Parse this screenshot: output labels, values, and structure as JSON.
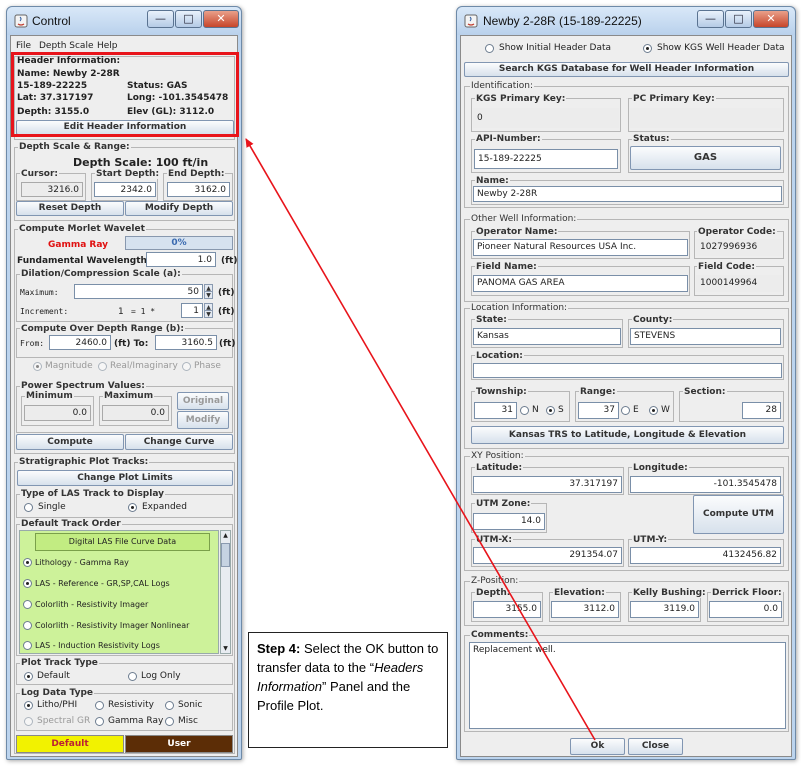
{
  "control": {
    "title": "Control",
    "menu": [
      "File",
      "Depth Scale",
      "Help"
    ],
    "header": {
      "section": "Header Information:",
      "name": "Name: Newby 2-28R",
      "api": "15-189-22225",
      "status": "Status: GAS",
      "lat": "Lat: 37.317197",
      "long": "Long: -101.3545478",
      "depth": "Depth: 3155.0",
      "elev": "Elev (GL): 3112.0",
      "edit_button": "Edit Header Information"
    },
    "depth": {
      "section": "Depth Scale & Range:",
      "scale_label": "Depth Scale: 100 ft/in",
      "cursor_label": "Cursor:",
      "cursor": "3216.0",
      "start_label": "Start Depth:",
      "start": "2342.0",
      "end_label": "End Depth:",
      "end": "3162.0",
      "reset_button": "Reset Depth",
      "modify_button": "Modify Depth"
    },
    "morlet": {
      "section": "Compute Morlet Wavelet",
      "curve": "Gamma Ray",
      "progress": "0%",
      "progress_value": 0,
      "fund_label": "Fundamental Wavelength (Wo):",
      "fund_value": "1.0",
      "ft": "(ft)",
      "dilation_label": "Dilation/Compression Scale (a):",
      "max_label": "Maximum:",
      "max_value": "50",
      "inc_label": "Increment:",
      "inc_a": "1",
      "inc_b": "= 1 *",
      "inc_value": "1",
      "range_label": "Compute Over Depth Range (b):",
      "from_label": "From:",
      "from_value": "2460.0",
      "to_label": "(ft) To:",
      "to_value": "3160.5",
      "magnitude": "Magnitude",
      "real": "Real/Imaginary",
      "phase": "Phase"
    },
    "power": {
      "section": "Power Spectrum Values:",
      "min_label": "Minimum",
      "min_value": "0.0",
      "max_label": "Maximum",
      "max_value": "0.0",
      "original_button": "Original",
      "modify_button": "Modify",
      "compute_button": "Compute",
      "change_curve_button": "Change Curve"
    },
    "strat": {
      "section": "Stratigraphic Plot Tracks:",
      "change_limits_button": "Change Plot Limits",
      "las_type_label": "Type of LAS Track to Display",
      "single": "Single",
      "expanded": "Expanded",
      "order_label": "Default Track Order",
      "tracks_header": "Digital LAS File Curve Data",
      "tracks": [
        "Lithology - Gamma Ray",
        "LAS - Reference - GR,SP,CAL Logs",
        "Colorlith - Resistivity Imager",
        "Colorlith - Resistivity Imager Nonlinear",
        "LAS - Induction Resistivity Logs"
      ],
      "plot_type_label": "Plot Track Type",
      "default": "Default",
      "log_only": "Log Only",
      "log_data_label": "Log Data Type",
      "litho": "Litho/PHI",
      "resistivity": "Resistivity",
      "sonic": "Sonic",
      "spectral": "Spectral GR",
      "gamma": "Gamma Ray",
      "misc": "Misc",
      "default_tab": "Default",
      "user_tab": "User"
    }
  },
  "well": {
    "title": "Newby 2-28R (15-189-22225)",
    "show_initial": "Show Initial Header Data",
    "show_kgs": "Show KGS Well Header Data",
    "search_button": "Search KGS Database for Well Header Information",
    "ident": {
      "section": "Identification:",
      "kgs_label": "KGS Primary Key:",
      "kgs_value": "0",
      "pc_label": "PC Primary Key:",
      "pc_value": "",
      "api_label": "API-Number:",
      "api_value": "15-189-22225",
      "status_label": "Status:",
      "status_value": "GAS",
      "name_label": "Name:",
      "name_value": "Newby 2-28R"
    },
    "other": {
      "section": "Other Well Information:",
      "op_label": "Operator Name:",
      "op_value": "Pioneer Natural Resources USA Inc.",
      "opcode_label": "Operator Code:",
      "opcode_value": "1027996936",
      "field_label": "Field Name:",
      "field_value": "PANOMA GAS AREA",
      "fcode_label": "Field Code:",
      "fcode_value": "1000149964"
    },
    "location": {
      "section": "Location Information:",
      "state_label": "State:",
      "state_value": "Kansas",
      "county_label": "County:",
      "county_value": "STEVENS",
      "loc_label": "Location:",
      "loc_value": "",
      "twp_label": "Township:",
      "twp_value": "31",
      "n": "N",
      "s": "S",
      "rng_label": "Range:",
      "rng_value": "37",
      "e": "E",
      "w": "W",
      "sec_label": "Section:",
      "sec_value": "28",
      "trs_button": "Kansas TRS to Latitude, Longitude & Elevation"
    },
    "xy": {
      "section": "XY Position:",
      "lat_label": "Latitude:",
      "lat_value": "37.317197",
      "long_label": "Longitude:",
      "long_value": "-101.3545478",
      "utmzone_label": "UTM Zone:",
      "utmzone_value": "14.0",
      "utm_button": "Compute UTM",
      "utmx_label": "UTM-X:",
      "utmx_value": "291354.07",
      "utmy_label": "UTM-Y:",
      "utmy_value": "4132456.82"
    },
    "z": {
      "section": "Z-Position:",
      "depth_label": "Depth:",
      "depth_value": "3155.0",
      "elev_label": "Elevation:",
      "elev_value": "3112.0",
      "kb_label": "Kelly Bushing:",
      "kb_value": "3119.0",
      "df_label": "Derrick Floor:",
      "df_value": "0.0"
    },
    "comments_label": "Comments:",
    "comments_value": "Replacement well.",
    "ok_button": "Ok",
    "close_button": "Close"
  },
  "callout": {
    "step": "Step 4:",
    "text_a": " Select the OK button to transfer data to the “",
    "text_em": "Headers Information",
    "text_b": "” Panel and the Profile Plot."
  },
  "colors": {
    "highlight": "#e8141b",
    "track_bg": "#cdf29a",
    "default_tab": "#f2f200",
    "user_tab": "#5c2d06",
    "gamma_red": "#e01010"
  }
}
